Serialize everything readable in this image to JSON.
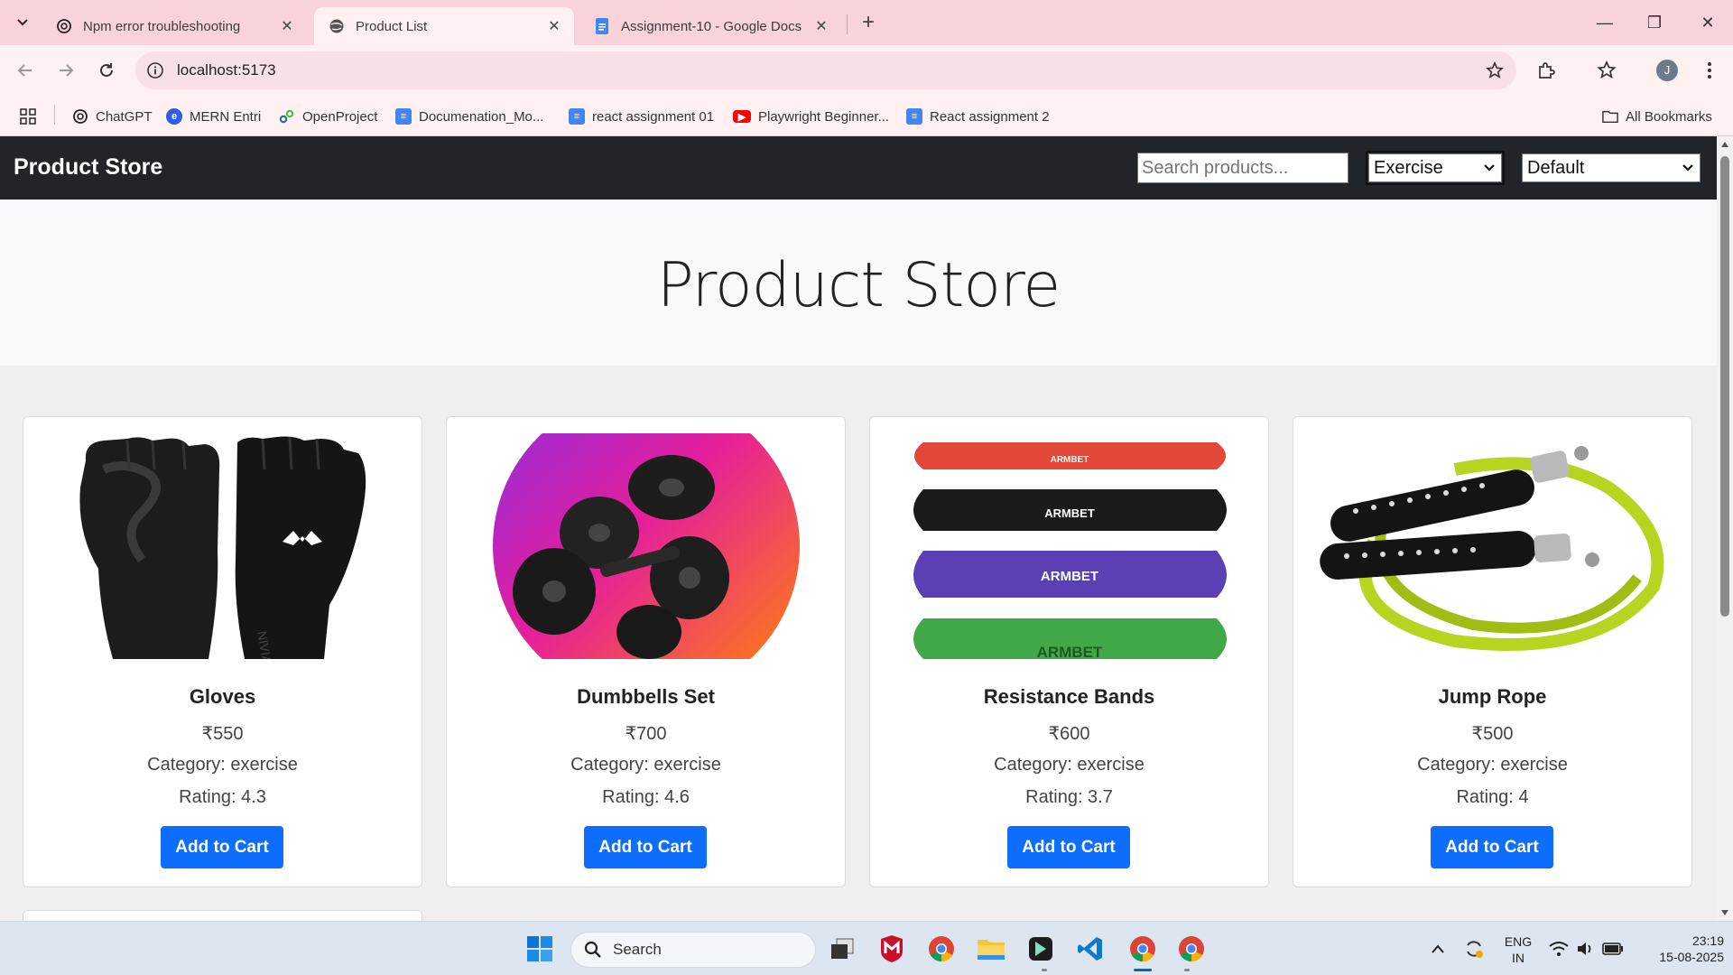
{
  "browser": {
    "tabs": [
      {
        "label": "Npm error troubleshooting",
        "icon": "chatgpt-icon"
      },
      {
        "label": "Product List",
        "icon": "globe-icon",
        "active": true
      },
      {
        "label": "Assignment-10 - Google Docs",
        "icon": "docs-icon"
      }
    ],
    "url": "localhost:5173",
    "avatar_initial": "J",
    "bookmarks": [
      {
        "label": "ChatGPT",
        "icon": "chatgpt-icon"
      },
      {
        "label": "MERN Entri",
        "icon": "entri-icon"
      },
      {
        "label": "OpenProject",
        "icon": "openproject-icon"
      },
      {
        "label": "Documenation_Mo...",
        "icon": "docs-icon"
      },
      {
        "label": "react assignment 01",
        "icon": "docs-icon"
      },
      {
        "label": "Playwright Beginner...",
        "icon": "youtube-icon"
      },
      {
        "label": "React assignment 2",
        "icon": "docs-icon"
      }
    ],
    "all_bookmarks": "All Bookmarks"
  },
  "store": {
    "brand": "Product Store",
    "search_placeholder": "Search products...",
    "category_selected": "Exercise",
    "sort_selected": "Default",
    "hero_title": "Product Store",
    "add_to_cart": "Add to Cart",
    "products": [
      {
        "name": "Gloves",
        "price": "₹550",
        "category": "Category: exercise",
        "rating": "Rating: 4.3"
      },
      {
        "name": "Dumbbells Set",
        "price": "₹700",
        "category": "Category: exercise",
        "rating": "Rating: 4.6"
      },
      {
        "name": "Resistance Bands",
        "price": "₹600",
        "category": "Category: exercise",
        "rating": "Rating: 3.7"
      },
      {
        "name": "Jump Rope",
        "price": "₹500",
        "category": "Category: exercise",
        "rating": "Rating: 4"
      }
    ],
    "band_labels": [
      "ARMBET",
      "ARMBET",
      "ARMBET",
      "ARMBET"
    ]
  },
  "taskbar": {
    "search_label": "Search",
    "language": "ENG",
    "region": "IN",
    "time": "23:19",
    "date": "15-08-2025"
  },
  "colors": {
    "tabstrip": "#f9d3da",
    "navbar": "#212529",
    "button": "#0d6efd"
  }
}
